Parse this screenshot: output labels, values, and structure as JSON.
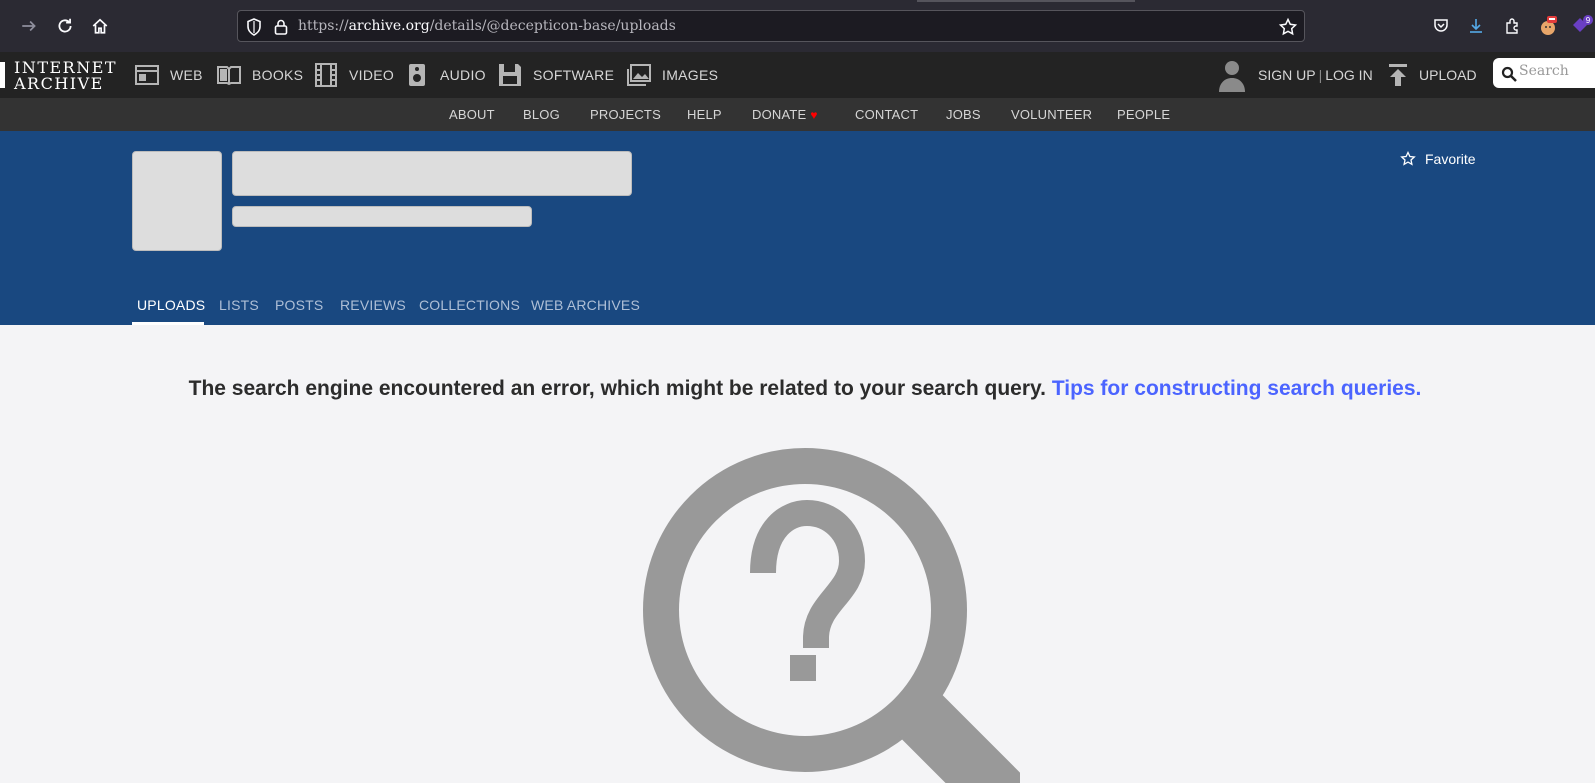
{
  "browser": {
    "url_prefix": "https://",
    "url_host": "archive.org",
    "url_path": "/details/@decepticon-base/uploads",
    "extension_badge": "9"
  },
  "ia_nav": {
    "logo_line1": "INTERNET",
    "logo_line2": "ARCHIVE",
    "media": [
      {
        "label": "WEB",
        "icon": "web-icon"
      },
      {
        "label": "BOOKS",
        "icon": "books-icon"
      },
      {
        "label": "VIDEO",
        "icon": "video-icon"
      },
      {
        "label": "AUDIO",
        "icon": "audio-icon"
      },
      {
        "label": "SOFTWARE",
        "icon": "software-icon"
      },
      {
        "label": "IMAGES",
        "icon": "images-icon"
      }
    ],
    "sign_up": "SIGN UP",
    "separator": "|",
    "log_in": "LOG IN",
    "upload": "UPLOAD",
    "search_placeholder": "Search"
  },
  "sub_nav": [
    "ABOUT",
    "BLOG",
    "PROJECTS",
    "HELP",
    "DONATE",
    "CONTACT",
    "JOBS",
    "VOLUNTEER",
    "PEOPLE"
  ],
  "banner": {
    "favorite": "Favorite",
    "tabs": [
      "UPLOADS",
      "LISTS",
      "POSTS",
      "REVIEWS",
      "COLLECTIONS",
      "WEB ARCHIVES"
    ],
    "active_tab": "UPLOADS"
  },
  "content": {
    "error_text": "The search engine encountered an error, which might be related to your search query.",
    "tips_link": "Tips for constructing search queries."
  },
  "colors": {
    "banner": "#194880",
    "link": "#4b64ff",
    "heart": "#ff0000"
  }
}
